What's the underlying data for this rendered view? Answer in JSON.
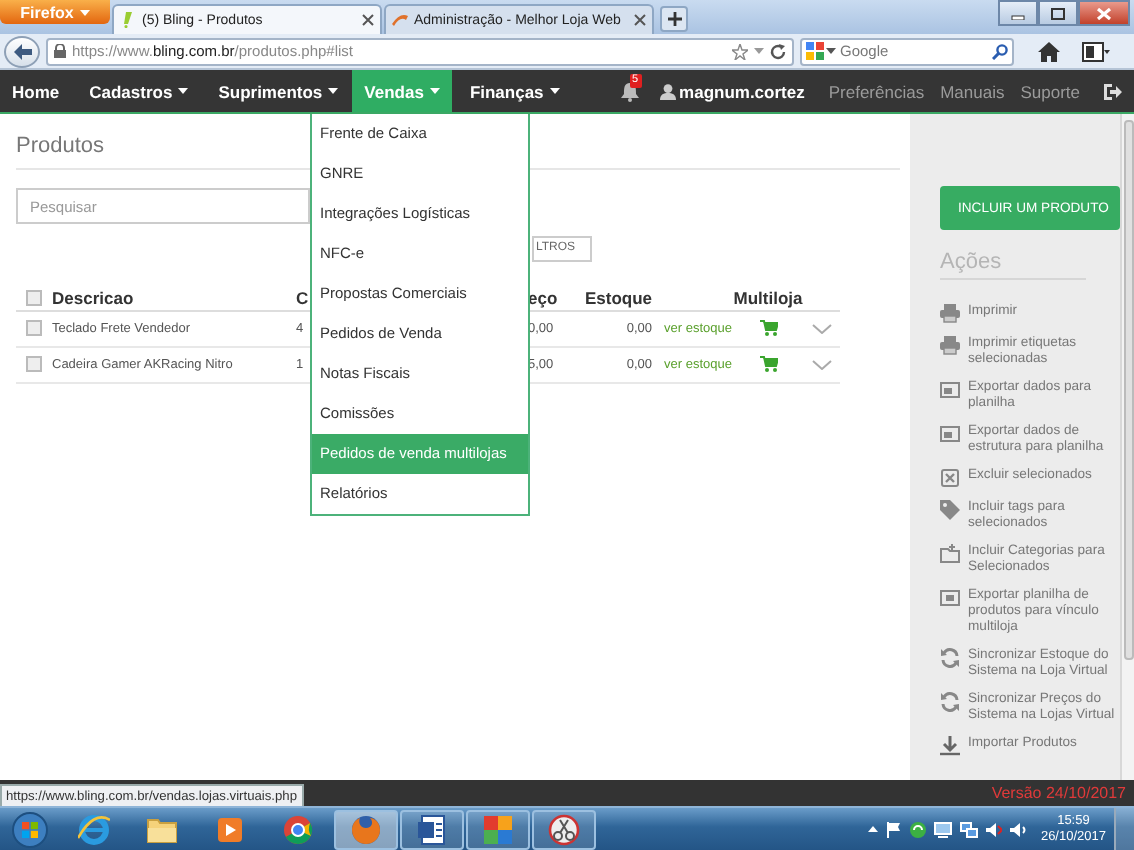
{
  "browser": {
    "menu_button": "Firefox",
    "tabs": [
      {
        "label": "(5) Bling - Produtos",
        "selected": true
      },
      {
        "label": "Administração - Melhor Loja Web",
        "selected": false
      }
    ],
    "url": "https://www.**bling.com.br**/produtos.php#list",
    "search": {
      "placeholder": "Google"
    }
  },
  "nav": {
    "items": [
      {
        "label": "Home",
        "dropdown": false,
        "selected": false
      },
      {
        "label": "Cadastros",
        "dropdown": true,
        "selected": false
      },
      {
        "label": "Suprimentos",
        "dropdown": true,
        "selected": false
      },
      {
        "label": "Vendas",
        "dropdown": true,
        "selected": true
      },
      {
        "label": "Finanças",
        "dropdown": true,
        "selected": false
      }
    ],
    "notifications": "5",
    "user": "magnum.cortez",
    "links": [
      "Preferências",
      "Manuais",
      "Suporte"
    ]
  },
  "page": {
    "title": "Produtos",
    "search": {
      "placeholder": "Pesquisar"
    },
    "filter_button": "LTROS",
    "table": {
      "select_all_checked": false,
      "columns": [
        "Descricao",
        "C",
        "eço",
        "Estoque",
        "Multiloja"
      ],
      "rows": [
        {
          "checked": false,
          "description": "Teclado Frete Vendedor",
          "column_2": "4",
          "price": "0,00",
          "stock": "0,00",
          "link": "ver estoque",
          "multiloja": true
        },
        {
          "checked": false,
          "description": "Cadeira Gamer AKRacing Nitro",
          "column_2": "1",
          "price": "5,00",
          "stock": "0,00",
          "link": "ver estoque",
          "multiloja": true
        }
      ]
    }
  },
  "dropdown": {
    "items": [
      {
        "label": "Frente de Caixa",
        "selected": false
      },
      {
        "label": "GNRE",
        "selected": false
      },
      {
        "label": "Integrações Logísticas",
        "selected": false
      },
      {
        "label": "NFC-e",
        "selected": false
      },
      {
        "label": "Propostas Comerciais",
        "selected": false
      },
      {
        "label": "Pedidos de Venda",
        "selected": false
      },
      {
        "label": "Notas Fiscais",
        "selected": false
      },
      {
        "label": "Comissões",
        "selected": false
      },
      {
        "label": "Pedidos de venda multilojas",
        "selected": true
      },
      {
        "label": "Relatórios",
        "selected": false
      }
    ]
  },
  "sidebar": {
    "primary_button": "INCLUIR UM PRODUTO",
    "section_title": "Ações",
    "actions": [
      {
        "kind": "printer",
        "label": "Imprimir"
      },
      {
        "kind": "printer",
        "label": "Imprimir etiquetas selecionadas"
      },
      {
        "kind": "sheet",
        "label": "Exportar dados para planilha"
      },
      {
        "kind": "sheet",
        "label": "Exportar dados de estrutura para planilha"
      },
      {
        "kind": "delete",
        "label": "Excluir selecionados"
      },
      {
        "kind": "tag",
        "label": "Incluir tags para selecionados"
      },
      {
        "kind": "folder",
        "label": "Incluir Categorias para Selecionados"
      },
      {
        "kind": "export",
        "label": "Exportar planilha de produtos para vínculo multiloja"
      },
      {
        "kind": "sync",
        "label": "Sincronizar Estoque do Sistema na Loja Virtual"
      },
      {
        "kind": "sync",
        "label": "Sincronizar Preços do Sistema na Lojas Virtual"
      },
      {
        "kind": "import",
        "label": "Importar Produtos"
      }
    ]
  },
  "status": {
    "link_preview": "https://www.bling.com.br/vendas.lojas.virtuais.php",
    "version": "Versão 24/10/2017"
  },
  "taskbar": {
    "apps": [
      {
        "kind": "ie",
        "running": false,
        "selected": false
      },
      {
        "kind": "folder",
        "running": false,
        "selected": false
      },
      {
        "kind": "media",
        "running": false,
        "selected": false
      },
      {
        "kind": "chrome",
        "running": false,
        "selected": false
      },
      {
        "kind": "firefox",
        "running": true,
        "selected": true
      },
      {
        "kind": "word",
        "running": true,
        "selected": false
      },
      {
        "kind": "tiles",
        "running": true,
        "selected": false
      },
      {
        "kind": "snip",
        "running": true,
        "selected": false
      }
    ],
    "clock": {
      "time": "15:59",
      "date": "26/10/2017"
    }
  }
}
